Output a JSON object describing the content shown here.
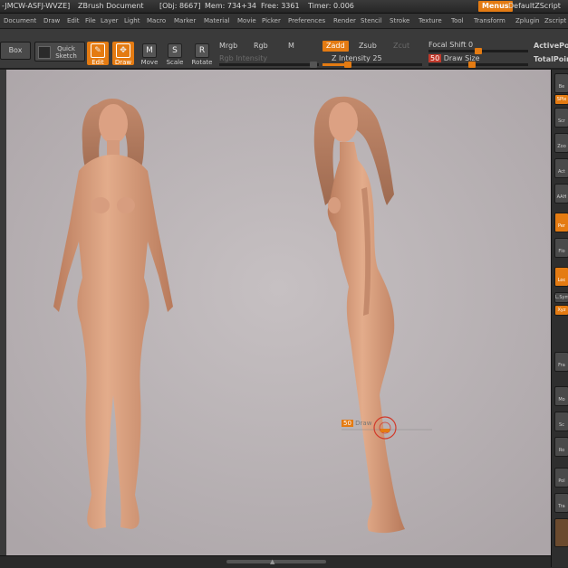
{
  "title_bar": {
    "project_id": "-JMCW-ASFJ-WVZE]",
    "document": "ZBrush Document",
    "obj": "[Obj: 8667]",
    "mem": "Mem: 734+34",
    "free": "Free: 3361",
    "timer": "Timer: 0.006",
    "menus_button": "Menus",
    "default_script": "DefaultZScript"
  },
  "menu_bar": {
    "items": [
      "Document",
      "Draw",
      "Edit",
      "File",
      "Layer",
      "Light",
      "Macro",
      "Marker",
      "Material",
      "Movie",
      "Picker",
      "Preferences",
      "Render",
      "Stencil",
      "Stroke",
      "Texture",
      "Tool",
      "Transform",
      "Zplugin",
      "Zscript"
    ]
  },
  "toolbar": {
    "lightbox": "Box",
    "quick_sketch": "Quick Sketch",
    "edit": "Edit",
    "draw": "Draw",
    "move": "Move",
    "scale": "Scale",
    "rotate": "Rotate",
    "mrgb": "Mrgb",
    "rgb": "Rgb",
    "m": "M",
    "rgb_intensity": "Rgb Intensity",
    "zadd": "Zadd",
    "zsub": "Zsub",
    "zcut": "Zcut",
    "z_intensity_label": "Z Intensity",
    "z_intensity_value": "25",
    "z_intensity_fraction": 0.25,
    "focal_shift_label": "Focal Shift",
    "focal_shift_value": "0",
    "draw_size_value": "50",
    "draw_size_label": "Draw Size",
    "active_points": "ActivePoi",
    "total_points": "TotalPoin"
  },
  "viewport": {
    "background_color": "#bdb7b9",
    "brush_cursor_size": "50",
    "brush_cursor_label": "Draw"
  },
  "right_shelf": {
    "buttons": [
      "Be",
      "SPix",
      "Scr",
      "Zoo",
      "Act",
      "AAH",
      "Per",
      "Flo",
      "Loc",
      "L.Sym",
      "Xyz",
      "Fra",
      "Mo",
      "Sc",
      "Ro",
      "Pol",
      "Tra"
    ]
  },
  "colors": {
    "accent": "#e47b12",
    "skin": "#d9a07f",
    "hair": "#b77a5e"
  }
}
